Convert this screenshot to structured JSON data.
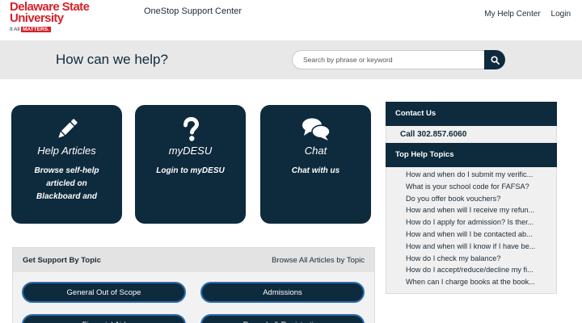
{
  "header": {
    "logo_line1": "Delaware State",
    "logo_line2": "University",
    "logo_tag_prefix": "It All",
    "logo_tag_highlight": "MATTERS.",
    "site_title": "OneStop Support Center",
    "nav": {
      "help_center": "My Help Center",
      "login": "Login"
    }
  },
  "hero": {
    "title": "How can we help?",
    "search_placeholder": "Search by phrase or keyword"
  },
  "tiles": [
    {
      "icon": "pencil-icon",
      "title": "Help Articles",
      "description": "Browse self-help articled on Blackboard and"
    },
    {
      "icon": "question-mark-icon",
      "title": "myDESU",
      "description": "Login to myDESU"
    },
    {
      "icon": "chat-bubbles-icon",
      "title": "Chat",
      "description": "Chat with us"
    }
  ],
  "topics": {
    "title": "Get Support By Topic",
    "browse_all": "Browse All Articles by Topic",
    "items": [
      "General Out of Scope",
      "Admissions",
      "Financial Aid",
      "Records & Registration"
    ]
  },
  "sidebar": {
    "contact_title": "Contact Us",
    "phone": "Call 302.857.6060",
    "top_topics_title": "Top Help Topics",
    "top_topics": [
      "How and when do I submit my verific...",
      "What is your school code for FAFSA?",
      "Do you offer book vouchers?",
      "How and when will I receive my refun...",
      "How do I apply for admission? Is ther...",
      "How and when will I be contacted ab...",
      "How and when will I know if I have be...",
      "How do I check my balance?",
      "How do I accept/reduce/decline my fi...",
      "When can I charge books at the book..."
    ]
  },
  "colors": {
    "navy": "#0e2a3d",
    "brand_red": "#d2232a",
    "pill_border": "#2b6cb0",
    "hero_bg": "#e8e8e8"
  }
}
